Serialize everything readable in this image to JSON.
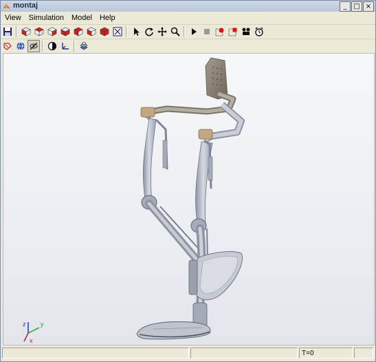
{
  "window": {
    "title": "montaj"
  },
  "window_controls": {
    "minimize": "_",
    "maximize": "□",
    "close": "×"
  },
  "menu": {
    "items": [
      "View",
      "Simulation",
      "Model",
      "Help"
    ]
  },
  "toolbar_primary": [
    "save-icon",
    "cube-view-icon",
    "cube-front-icon",
    "cube-back-icon",
    "cube-left-icon",
    "cube-right-icon",
    "cube-top-icon",
    "cube-bottom-icon",
    "fit-view-icon",
    "pointer-icon",
    "rotate-icon",
    "pan-icon",
    "zoom-icon",
    "play-icon",
    "stop-icon",
    "record-icon",
    "record-stop-icon",
    "camera-icon",
    "timer-icon"
  ],
  "toolbar_secondary": [
    "display-mode-icon",
    "globe-icon",
    "visibility-icon",
    "shading-icon",
    "axes-icon",
    "layers-icon"
  ],
  "axes": {
    "x": "x",
    "y": "y",
    "z": "z"
  },
  "status": {
    "time": "T=0"
  },
  "colors": {
    "body_gray": "#b8bcc6",
    "plate_brown": "#8c8476",
    "axis_x": "#c02020",
    "axis_y": "#20a020",
    "axis_z": "#2030c0"
  }
}
